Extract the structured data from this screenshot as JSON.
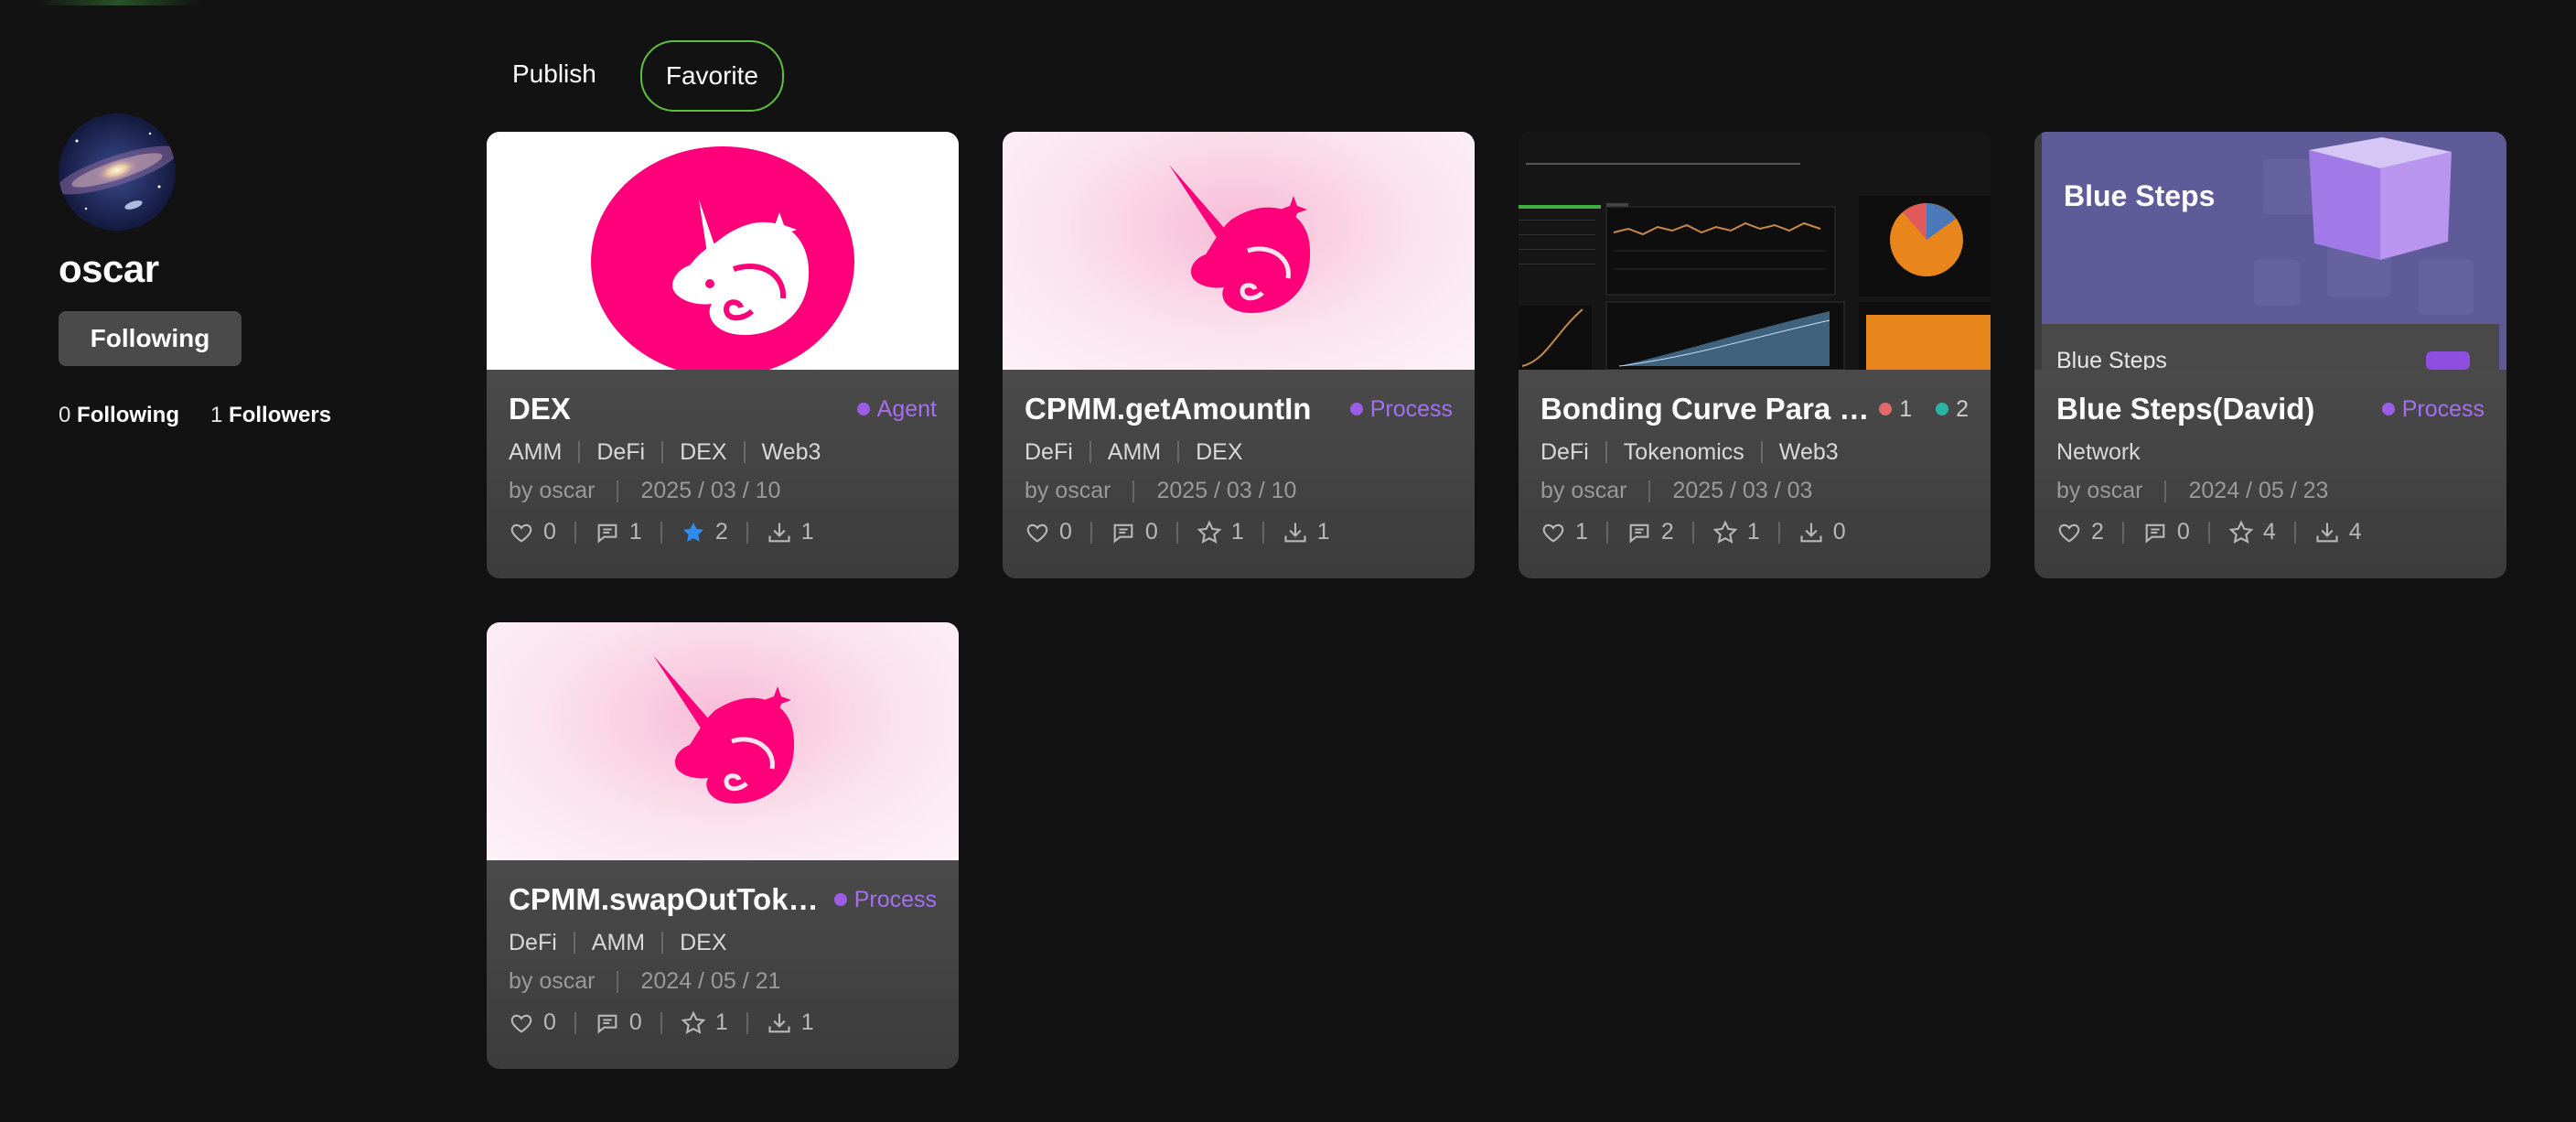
{
  "profile": {
    "username": "oscar",
    "follow_button": "Following",
    "following_count": "0",
    "following_label": "Following",
    "followers_count": "1",
    "followers_label": "Followers"
  },
  "tabs": [
    {
      "label": "Publish",
      "active": false
    },
    {
      "label": "Favorite",
      "active": true
    }
  ],
  "cards": [
    {
      "title": "DEX",
      "badge": "Agent",
      "tags": [
        "AMM",
        "DeFi",
        "DEX",
        "Web3"
      ],
      "author": "by oscar",
      "date": "2025 / 03 / 10",
      "likes": "0",
      "comments": "1",
      "stars": "2",
      "downloads": "1"
    },
    {
      "title": "CPMM.getAmountIn",
      "badge": "Process",
      "tags": [
        "DeFi",
        "AMM",
        "DEX"
      ],
      "author": "by oscar",
      "date": "2025 / 03 / 10",
      "likes": "0",
      "comments": "0",
      "stars": "1",
      "downloads": "1"
    },
    {
      "title": "Bonding Curve Para E...",
      "status_red": "1",
      "status_teal": "2",
      "tags": [
        "DeFi",
        "Tokenomics",
        "Web3"
      ],
      "author": "by oscar",
      "date": "2025 / 03 / 03",
      "likes": "1",
      "comments": "2",
      "stars": "1",
      "downloads": "0"
    },
    {
      "title": "Blue Steps(David)",
      "badge": "Process",
      "thumb_title": "Blue Steps",
      "thumb_caption": "Blue Steps",
      "tags": [
        "Network"
      ],
      "author": "by oscar",
      "date": "2024 / 05 / 23",
      "likes": "2",
      "comments": "0",
      "stars": "4",
      "downloads": "4"
    },
    {
      "title": "CPMM.swapOutToken",
      "badge": "Process",
      "tags": [
        "DeFi",
        "AMM",
        "DEX"
      ],
      "author": "by oscar",
      "date": "2024 / 05 / 21",
      "likes": "0",
      "comments": "0",
      "stars": "1",
      "downloads": "1"
    }
  ],
  "colors": {
    "background": "#121212",
    "accent_green": "#5ec13a",
    "badge_purple": "#9b5de5",
    "star_active": "#2f8cf0",
    "unicorn_pink": "#ff007a"
  }
}
